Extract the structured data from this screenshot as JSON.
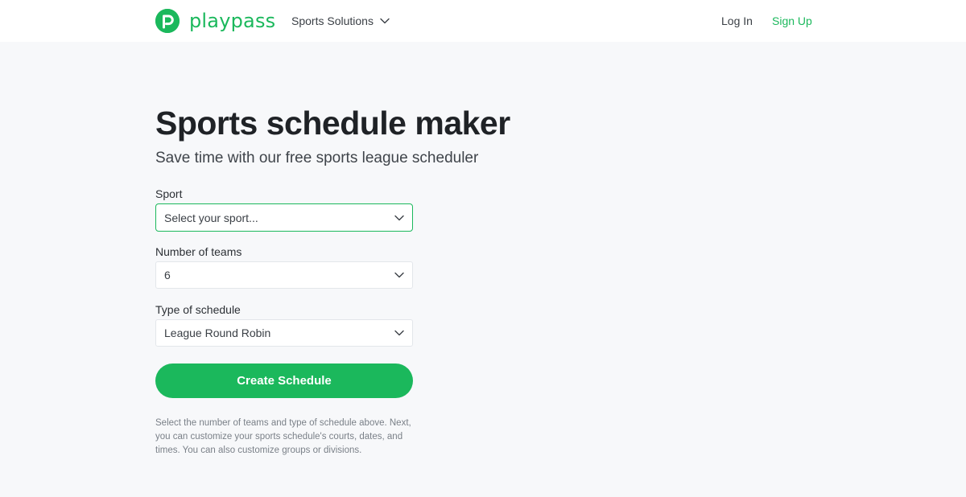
{
  "brand": {
    "name": "playpass",
    "accent_color": "#1bb85c"
  },
  "nav": {
    "solutions_label": "Sports Solutions",
    "login_label": "Log In",
    "signup_label": "Sign Up"
  },
  "page": {
    "title": "Sports schedule maker",
    "subtitle": "Save time with our free sports league scheduler"
  },
  "form": {
    "sport": {
      "label": "Sport",
      "value": "Select your sport..."
    },
    "teams": {
      "label": "Number of teams",
      "value": "6"
    },
    "schedule_type": {
      "label": "Type of schedule",
      "value": "League Round Robin"
    },
    "submit_label": "Create Schedule",
    "help_text": "Select the number of teams and type of schedule above. Next, you can customize your sports schedule's courts, dates, and times. You can also customize groups or divisions."
  },
  "icons": {
    "logo": "playpass-logo-icon",
    "dropdown": "chevron-down-icon"
  }
}
